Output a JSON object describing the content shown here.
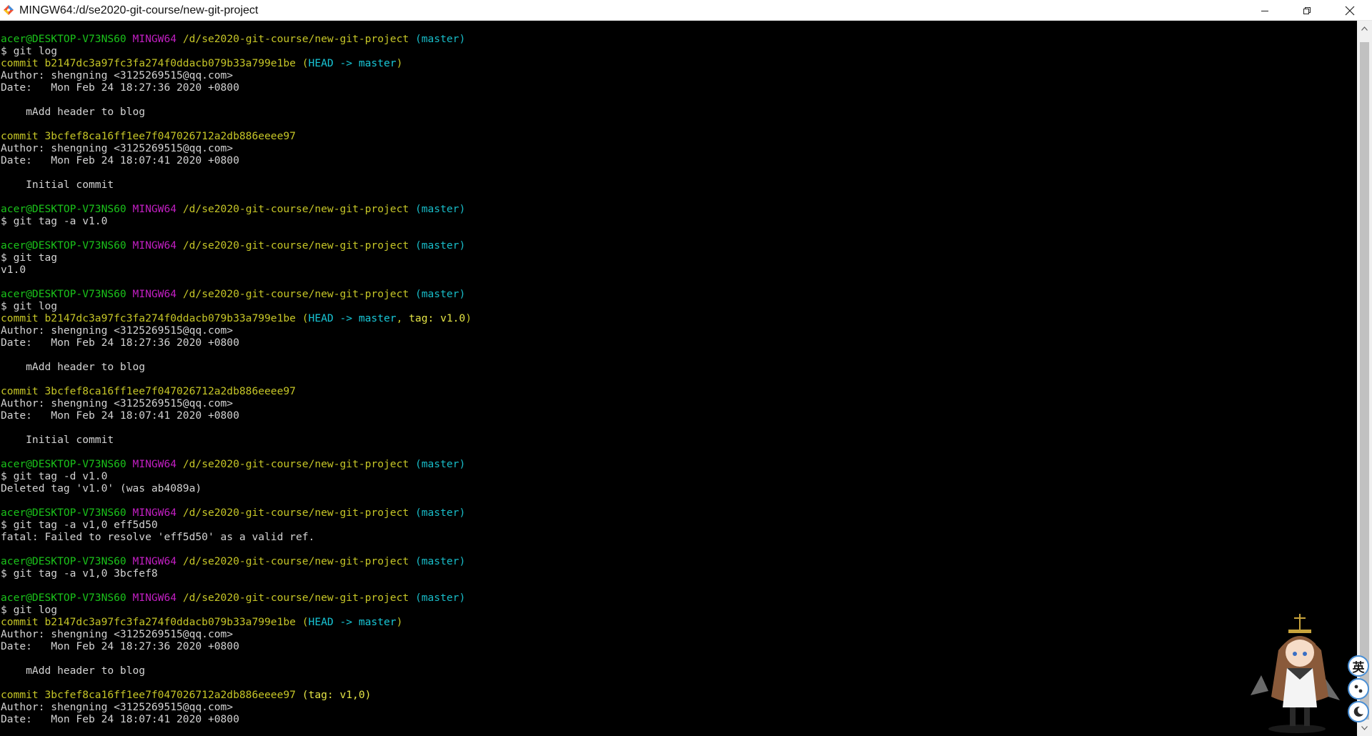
{
  "window": {
    "title": "MINGW64:/d/se2020-git-course/new-git-project",
    "app_icon": "git-bash-icon",
    "controls": [
      "minimize-icon",
      "restore-icon",
      "close-icon"
    ]
  },
  "colors": {
    "background": "#000000",
    "text": "#d3d3d3",
    "prompt_user": "#1ac31a",
    "prompt_host": "#c21fc2",
    "prompt_path": "#c6c627",
    "prompt_branch": "#18bcc8",
    "commit_hash": "#c6c627",
    "ref_head": "#18c6d6",
    "ref_tag": "#e4e446"
  },
  "terminal": {
    "lines": [
      {
        "segs": [
          {
            "c": "user",
            "t": "acer@DESKTOP-V73NS60"
          },
          {
            "c": "",
            "t": " "
          },
          {
            "c": "host",
            "t": "MINGW64"
          },
          {
            "c": "",
            "t": " "
          },
          {
            "c": "path",
            "t": "/d/se2020-git-course/new-git-project"
          },
          {
            "c": "",
            "t": " "
          },
          {
            "c": "branch",
            "t": "(master)"
          }
        ]
      },
      {
        "segs": [
          {
            "c": "",
            "t": "$ git log"
          }
        ]
      },
      {
        "segs": [
          {
            "c": "hash",
            "t": "commit b2147dc3a97fc3fa274f0ddacb079b33a799e1be"
          },
          {
            "c": "",
            "t": " "
          },
          {
            "c": "hash",
            "t": "("
          },
          {
            "c": "ref",
            "t": "HEAD -> master"
          },
          {
            "c": "hash",
            "t": ")"
          }
        ]
      },
      {
        "segs": [
          {
            "c": "",
            "t": "Author: shengning <3125269515@qq.com>"
          }
        ]
      },
      {
        "segs": [
          {
            "c": "",
            "t": "Date:   Mon Feb 24 18:27:36 2020 +0800"
          }
        ]
      },
      {
        "segs": []
      },
      {
        "segs": [
          {
            "c": "",
            "t": "    mAdd header to blog"
          }
        ]
      },
      {
        "segs": []
      },
      {
        "segs": [
          {
            "c": "hash",
            "t": "commit 3bcfef8ca16ff1ee7f047026712a2db886eeee97"
          }
        ]
      },
      {
        "segs": [
          {
            "c": "",
            "t": "Author: shengning <3125269515@qq.com>"
          }
        ]
      },
      {
        "segs": [
          {
            "c": "",
            "t": "Date:   Mon Feb 24 18:07:41 2020 +0800"
          }
        ]
      },
      {
        "segs": []
      },
      {
        "segs": [
          {
            "c": "",
            "t": "    Initial commit"
          }
        ]
      },
      {
        "segs": []
      },
      {
        "segs": [
          {
            "c": "user",
            "t": "acer@DESKTOP-V73NS60"
          },
          {
            "c": "",
            "t": " "
          },
          {
            "c": "host",
            "t": "MINGW64"
          },
          {
            "c": "",
            "t": " "
          },
          {
            "c": "path",
            "t": "/d/se2020-git-course/new-git-project"
          },
          {
            "c": "",
            "t": " "
          },
          {
            "c": "branch",
            "t": "(master)"
          }
        ]
      },
      {
        "segs": [
          {
            "c": "",
            "t": "$ git tag -a v1.0"
          }
        ]
      },
      {
        "segs": []
      },
      {
        "segs": [
          {
            "c": "user",
            "t": "acer@DESKTOP-V73NS60"
          },
          {
            "c": "",
            "t": " "
          },
          {
            "c": "host",
            "t": "MINGW64"
          },
          {
            "c": "",
            "t": " "
          },
          {
            "c": "path",
            "t": "/d/se2020-git-course/new-git-project"
          },
          {
            "c": "",
            "t": " "
          },
          {
            "c": "branch",
            "t": "(master)"
          }
        ]
      },
      {
        "segs": [
          {
            "c": "",
            "t": "$ git tag"
          }
        ]
      },
      {
        "segs": [
          {
            "c": "",
            "t": "v1.0"
          }
        ]
      },
      {
        "segs": []
      },
      {
        "segs": [
          {
            "c": "user",
            "t": "acer@DESKTOP-V73NS60"
          },
          {
            "c": "",
            "t": " "
          },
          {
            "c": "host",
            "t": "MINGW64"
          },
          {
            "c": "",
            "t": " "
          },
          {
            "c": "path",
            "t": "/d/se2020-git-course/new-git-project"
          },
          {
            "c": "",
            "t": " "
          },
          {
            "c": "branch",
            "t": "(master)"
          }
        ]
      },
      {
        "segs": [
          {
            "c": "",
            "t": "$ git log"
          }
        ]
      },
      {
        "segs": [
          {
            "c": "hash",
            "t": "commit b2147dc3a97fc3fa274f0ddacb079b33a799e1be"
          },
          {
            "c": "",
            "t": " "
          },
          {
            "c": "hash",
            "t": "("
          },
          {
            "c": "ref",
            "t": "HEAD -> master"
          },
          {
            "c": "hash",
            "t": ", "
          },
          {
            "c": "tag",
            "t": "tag: v1.0"
          },
          {
            "c": "hash",
            "t": ")"
          }
        ]
      },
      {
        "segs": [
          {
            "c": "",
            "t": "Author: shengning <3125269515@qq.com>"
          }
        ]
      },
      {
        "segs": [
          {
            "c": "",
            "t": "Date:   Mon Feb 24 18:27:36 2020 +0800"
          }
        ]
      },
      {
        "segs": []
      },
      {
        "segs": [
          {
            "c": "",
            "t": "    mAdd header to blog"
          }
        ]
      },
      {
        "segs": []
      },
      {
        "segs": [
          {
            "c": "hash",
            "t": "commit 3bcfef8ca16ff1ee7f047026712a2db886eeee97"
          }
        ]
      },
      {
        "segs": [
          {
            "c": "",
            "t": "Author: shengning <3125269515@qq.com>"
          }
        ]
      },
      {
        "segs": [
          {
            "c": "",
            "t": "Date:   Mon Feb 24 18:07:41 2020 +0800"
          }
        ]
      },
      {
        "segs": []
      },
      {
        "segs": [
          {
            "c": "",
            "t": "    Initial commit"
          }
        ]
      },
      {
        "segs": []
      },
      {
        "segs": [
          {
            "c": "user",
            "t": "acer@DESKTOP-V73NS60"
          },
          {
            "c": "",
            "t": " "
          },
          {
            "c": "host",
            "t": "MINGW64"
          },
          {
            "c": "",
            "t": " "
          },
          {
            "c": "path",
            "t": "/d/se2020-git-course/new-git-project"
          },
          {
            "c": "",
            "t": " "
          },
          {
            "c": "branch",
            "t": "(master)"
          }
        ]
      },
      {
        "segs": [
          {
            "c": "",
            "t": "$ git tag -d v1.0"
          }
        ]
      },
      {
        "segs": [
          {
            "c": "",
            "t": "Deleted tag 'v1.0' (was ab4089a)"
          }
        ]
      },
      {
        "segs": []
      },
      {
        "segs": [
          {
            "c": "user",
            "t": "acer@DESKTOP-V73NS60"
          },
          {
            "c": "",
            "t": " "
          },
          {
            "c": "host",
            "t": "MINGW64"
          },
          {
            "c": "",
            "t": " "
          },
          {
            "c": "path",
            "t": "/d/se2020-git-course/new-git-project"
          },
          {
            "c": "",
            "t": " "
          },
          {
            "c": "branch",
            "t": "(master)"
          }
        ]
      },
      {
        "segs": [
          {
            "c": "",
            "t": "$ git tag -a v1,0 eff5d50"
          }
        ]
      },
      {
        "segs": [
          {
            "c": "",
            "t": "fatal: Failed to resolve 'eff5d50' as a valid ref."
          }
        ]
      },
      {
        "segs": []
      },
      {
        "segs": [
          {
            "c": "user",
            "t": "acer@DESKTOP-V73NS60"
          },
          {
            "c": "",
            "t": " "
          },
          {
            "c": "host",
            "t": "MINGW64"
          },
          {
            "c": "",
            "t": " "
          },
          {
            "c": "path",
            "t": "/d/se2020-git-course/new-git-project"
          },
          {
            "c": "",
            "t": " "
          },
          {
            "c": "branch",
            "t": "(master)"
          }
        ]
      },
      {
        "segs": [
          {
            "c": "",
            "t": "$ git tag -a v1,0 3bcfef8"
          }
        ]
      },
      {
        "segs": []
      },
      {
        "segs": [
          {
            "c": "user",
            "t": "acer@DESKTOP-V73NS60"
          },
          {
            "c": "",
            "t": " "
          },
          {
            "c": "host",
            "t": "MINGW64"
          },
          {
            "c": "",
            "t": " "
          },
          {
            "c": "path",
            "t": "/d/se2020-git-course/new-git-project"
          },
          {
            "c": "",
            "t": " "
          },
          {
            "c": "branch",
            "t": "(master)"
          }
        ]
      },
      {
        "segs": [
          {
            "c": "",
            "t": "$ git log"
          }
        ]
      },
      {
        "segs": [
          {
            "c": "hash",
            "t": "commit b2147dc3a97fc3fa274f0ddacb079b33a799e1be"
          },
          {
            "c": "",
            "t": " "
          },
          {
            "c": "hash",
            "t": "("
          },
          {
            "c": "ref",
            "t": "HEAD -> master"
          },
          {
            "c": "hash",
            "t": ")"
          }
        ]
      },
      {
        "segs": [
          {
            "c": "",
            "t": "Author: shengning <3125269515@qq.com>"
          }
        ]
      },
      {
        "segs": [
          {
            "c": "",
            "t": "Date:   Mon Feb 24 18:27:36 2020 +0800"
          }
        ]
      },
      {
        "segs": []
      },
      {
        "segs": [
          {
            "c": "",
            "t": "    mAdd header to blog"
          }
        ]
      },
      {
        "segs": []
      },
      {
        "segs": [
          {
            "c": "hash",
            "t": "commit 3bcfef8ca16ff1ee7f047026712a2db886eeee97"
          },
          {
            "c": "",
            "t": " "
          },
          {
            "c": "tag",
            "t": "(tag: v1,0)"
          }
        ]
      },
      {
        "segs": [
          {
            "c": "",
            "t": "Author: shengning <3125269515@qq.com>"
          }
        ]
      },
      {
        "segs": [
          {
            "c": "",
            "t": "Date:   Mon Feb 24 18:07:41 2020 +0800"
          }
        ]
      }
    ]
  },
  "ime": {
    "language_label": "英",
    "icons": [
      "ime-language-icon",
      "punctuation-icon",
      "half-width-moon-icon"
    ],
    "mascot": "anime-mascot-icon"
  },
  "scrollbar": {
    "icons": [
      "scroll-up-arrow-icon",
      "scroll-down-arrow-icon"
    ]
  }
}
